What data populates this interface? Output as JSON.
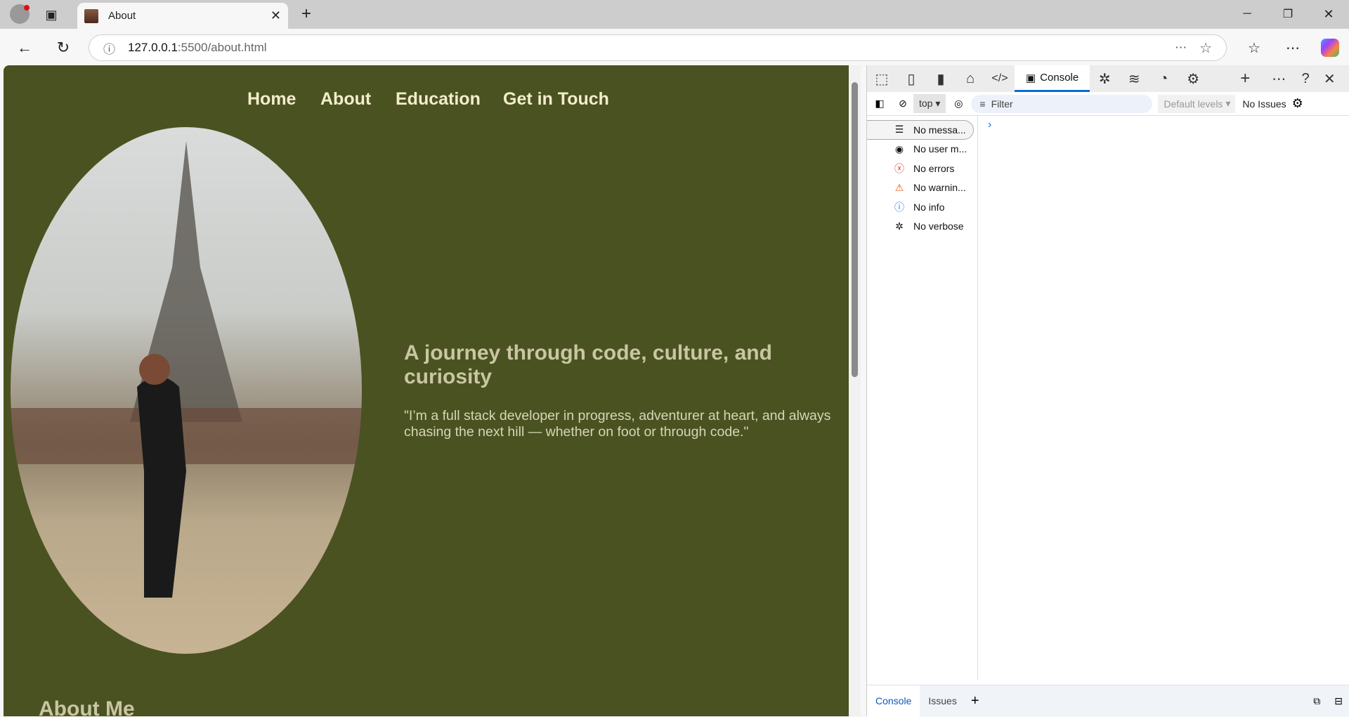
{
  "browser": {
    "tab_title": "About",
    "url_host": "127.0.0.1",
    "url_path": ":5500/about.html"
  },
  "nav": {
    "items": [
      "Home",
      "About",
      "Education",
      "Get in Touch"
    ]
  },
  "hero": {
    "heading": "A journey through code, culture, and curiosity",
    "quote": "\"I’m a full stack developer in progress, adventurer at heart, and always chasing the next hill — whether on foot or through code.\""
  },
  "section": {
    "about_me": "About Me"
  },
  "devtools": {
    "active_tab": "Console",
    "context": "top",
    "filter_placeholder": "Filter",
    "levels": "Default levels",
    "issues": "No Issues",
    "sidebar": [
      "No messa...",
      "No user m...",
      "No errors",
      "No warnin...",
      "No info",
      "No verbose"
    ],
    "bottom_tabs": [
      "Console",
      "Issues"
    ]
  },
  "colors": {
    "page_bg": "#4a5221",
    "nav_text": "#f3edcc",
    "heading": "#c9c6a2",
    "accent": "#0a6dd6"
  }
}
